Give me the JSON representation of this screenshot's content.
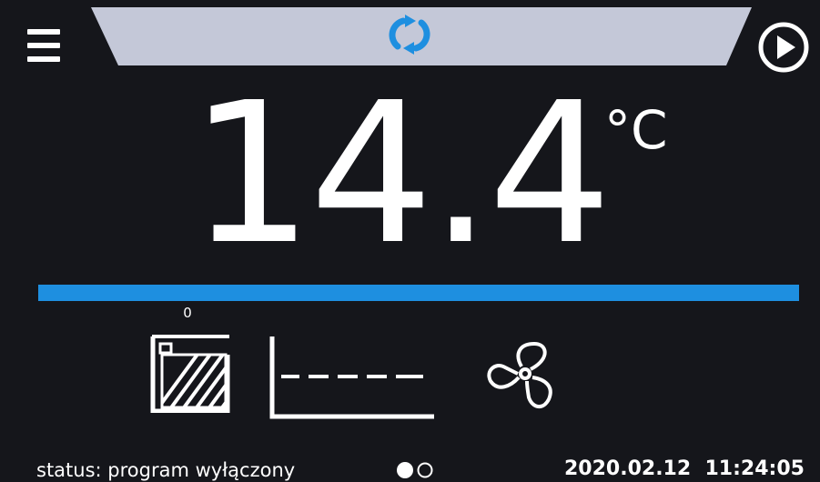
{
  "header": {
    "menu_icon": "hamburger-menu-icon",
    "mode_icon": "sync-cycle-icon",
    "play_icon": "play-circle-icon",
    "banner_color": "#c4c8d8",
    "accent_color": "#1e8fe0"
  },
  "reading": {
    "value": "14.4",
    "unit": "°C"
  },
  "progress": {
    "level": 1.0,
    "color": "#1e8fe0"
  },
  "indicators": {
    "heater_level": "0",
    "heater_icon": "heater-icon",
    "graph_icon": "temperature-graph-icon",
    "fan_icon": "fan-icon"
  },
  "footer": {
    "status": "status: program wyłączony",
    "pages": {
      "count": 2,
      "active": 0
    },
    "datetime": "2020.02.12  11:24:05"
  }
}
